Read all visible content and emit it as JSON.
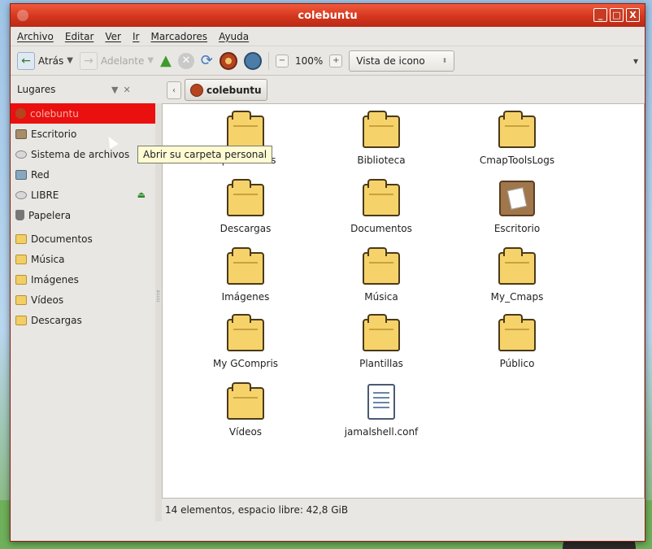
{
  "window": {
    "title": "colebuntu",
    "wm_buttons": [
      "_",
      "□",
      "X"
    ]
  },
  "menubar": {
    "items": [
      "Archivo",
      "Editar",
      "Ver",
      "Ir",
      "Marcadores",
      "Ayuda"
    ]
  },
  "toolbar": {
    "back_label": "Atrás",
    "forward_label": "Adelante",
    "zoom_value": "100%",
    "view_mode": "Vista de icono"
  },
  "sidebar": {
    "header": "Lugares",
    "places": [
      {
        "label": "colebuntu",
        "icon": "home-icon",
        "active": true
      },
      {
        "label": "Escritorio",
        "icon": "desktop-icon"
      },
      {
        "label": "Sistema de archivos",
        "icon": "filesystem-icon"
      },
      {
        "label": "Red",
        "icon": "network-icon"
      },
      {
        "label": "LIBRE",
        "icon": "drive-icon"
      },
      {
        "label": "Papelera",
        "icon": "trash-icon"
      }
    ],
    "bookmarks": [
      {
        "label": "Documentos",
        "icon": "folder-icon"
      },
      {
        "label": "Música",
        "icon": "folder-icon"
      },
      {
        "label": "Imágenes",
        "icon": "folder-icon"
      },
      {
        "label": "Vídeos",
        "icon": "folder-icon"
      },
      {
        "label": "Descargas",
        "icon": "folder-icon"
      }
    ],
    "tooltip": "Abrir su carpeta personal"
  },
  "location": {
    "current": "colebuntu"
  },
  "files": [
    {
      "name": "Aplicaciones",
      "icon": "folder-icon"
    },
    {
      "name": "Biblioteca",
      "icon": "folder-icon"
    },
    {
      "name": "CmapToolsLogs",
      "icon": "folder-icon"
    },
    {
      "name": "Descargas",
      "icon": "folder-icon"
    },
    {
      "name": "Documentos",
      "icon": "folder-icon"
    },
    {
      "name": "Escritorio",
      "icon": "desktop-icon"
    },
    {
      "name": "Imágenes",
      "icon": "folder-icon"
    },
    {
      "name": "Música",
      "icon": "folder-icon"
    },
    {
      "name": "My_Cmaps",
      "icon": "folder-icon"
    },
    {
      "name": "My GCompris",
      "icon": "folder-icon"
    },
    {
      "name": "Plantillas",
      "icon": "folder-icon"
    },
    {
      "name": "Público",
      "icon": "folder-icon"
    },
    {
      "name": "Vídeos",
      "icon": "folder-icon"
    },
    {
      "name": "jamalshell.conf",
      "icon": "text-file-icon"
    }
  ],
  "statusbar": {
    "text": "14 elementos, espacio libre: 42,8 GiB"
  },
  "colors": {
    "titlebar": "#d4361d",
    "active_place": "#ea1010",
    "tooltip_bg": "#fffbd3"
  }
}
